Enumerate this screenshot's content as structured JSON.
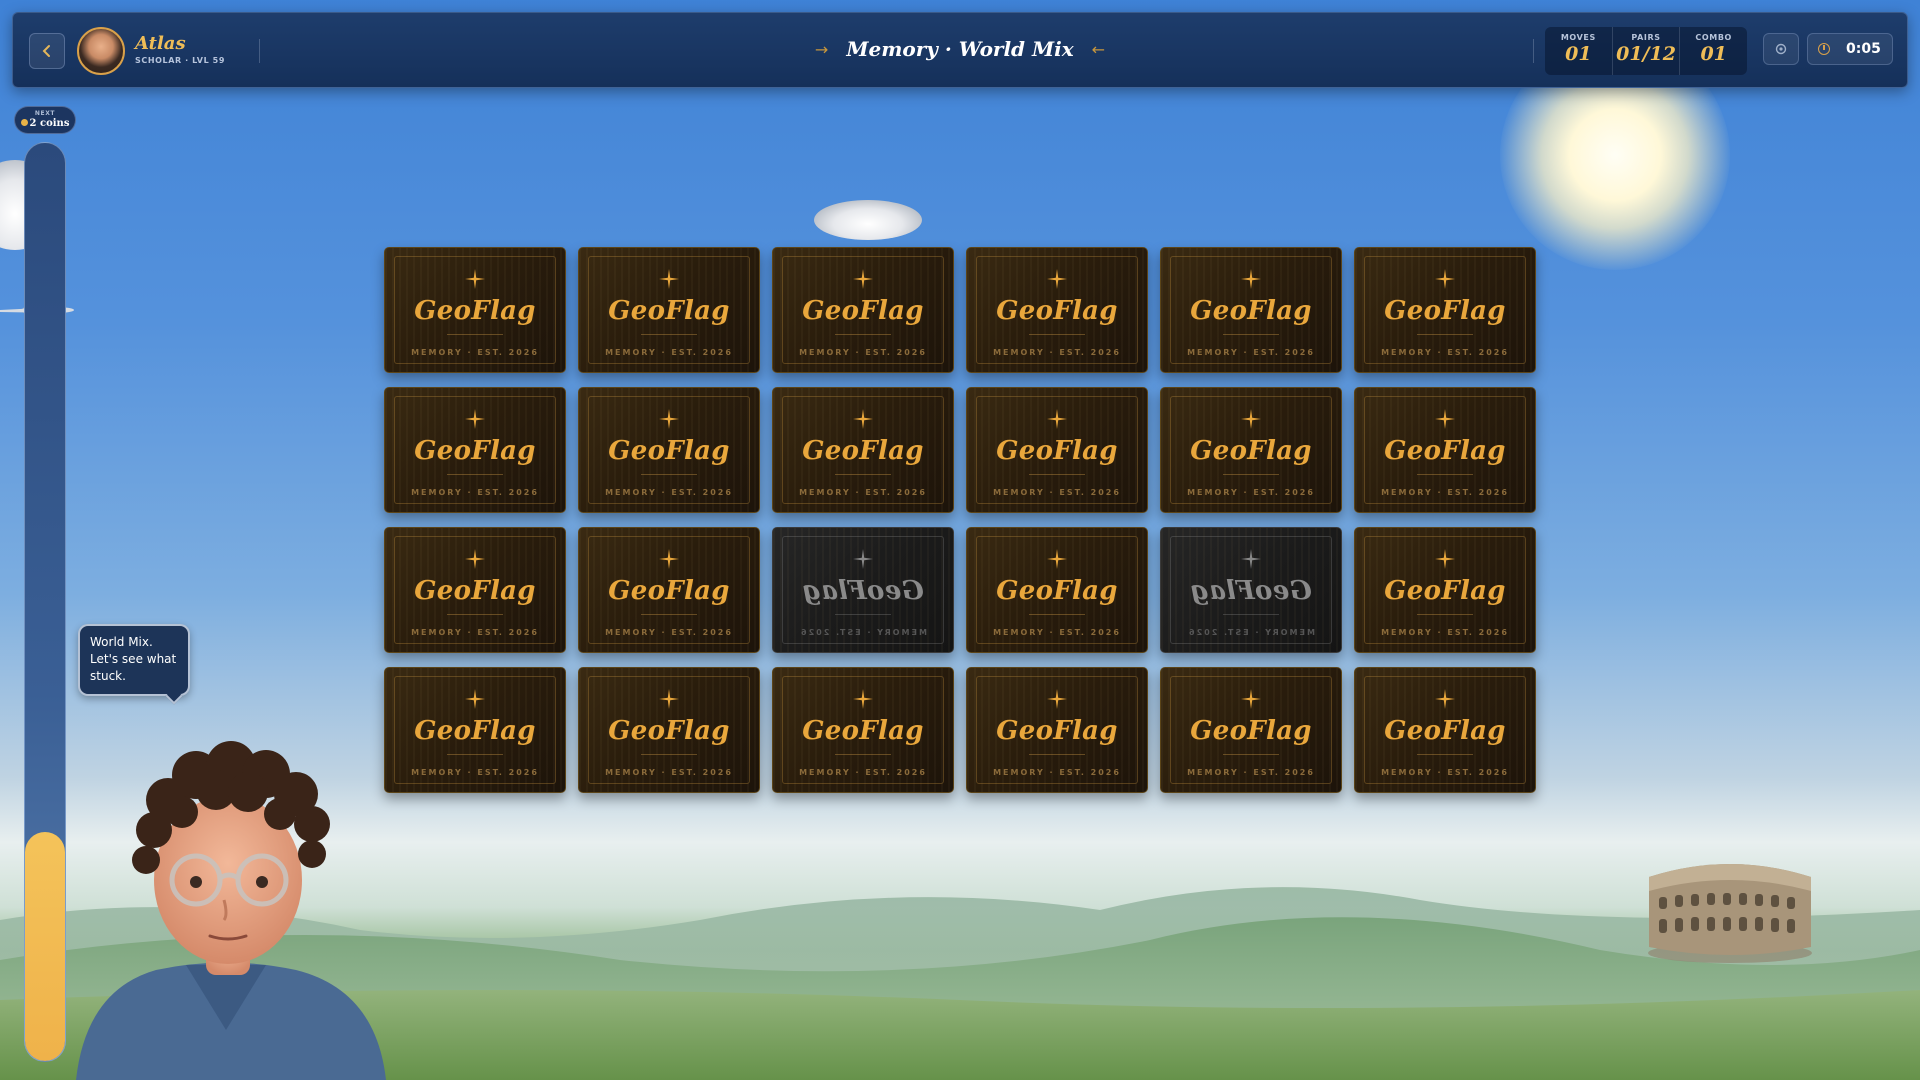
{
  "header": {
    "back_icon": "chevron-left-icon",
    "player": {
      "name": "Atlas",
      "rank": "SCHOLAR · LVL 59"
    },
    "title": "Memory · World Mix",
    "title_arrow_left": "→",
    "title_arrow_right": "←",
    "stats": [
      {
        "label": "MOVES",
        "value": "01"
      },
      {
        "label": "PAIRS",
        "value": "01/12"
      },
      {
        "label": "COMBO",
        "value": "01"
      }
    ],
    "settings_icon": "gear-icon",
    "timer_icon": "clock-icon",
    "timer": "0:05"
  },
  "reward": {
    "label": "NEXT",
    "value": "2 coins",
    "icon": "coin-icon"
  },
  "progress": {
    "fraction": 0.25
  },
  "speech": {
    "text": "World Mix. Let's see what stuck."
  },
  "board": {
    "rows": 4,
    "cols": 6,
    "card_logo": "GeoFlag",
    "card_sub": "MEMORY · EST. 2026",
    "flipping_indices": [
      14,
      16
    ]
  },
  "colors": {
    "accent_gold": "#efbd57",
    "card_gold": "#e9a73c",
    "topbar": "#1a3764",
    "progress_fill": "#f1b94f"
  }
}
